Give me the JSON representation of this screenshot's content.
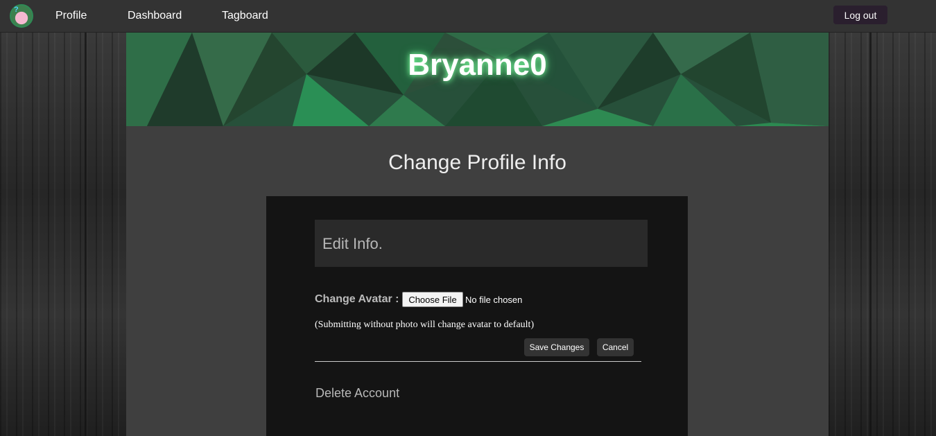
{
  "nav": {
    "links": [
      "Profile",
      "Dashboard",
      "Tagboard"
    ],
    "logout_label": "Log out"
  },
  "banner": {
    "username": "Bryanne0"
  },
  "page": {
    "title": "Change Profile Info"
  },
  "form": {
    "header": "Edit Info.",
    "avatar_label": "Change Avatar :",
    "file_button": "Choose File",
    "file_status": "No file chosen",
    "hint": "(Submitting without photo will change avatar to default)",
    "save_label": "Save Changes",
    "cancel_label": "Cancel",
    "delete_label": "Delete Account"
  },
  "colors": {
    "navbar": "#333333",
    "banner_green": "#2e7d4a",
    "card": "#141414",
    "main": "#3f3f3f"
  }
}
